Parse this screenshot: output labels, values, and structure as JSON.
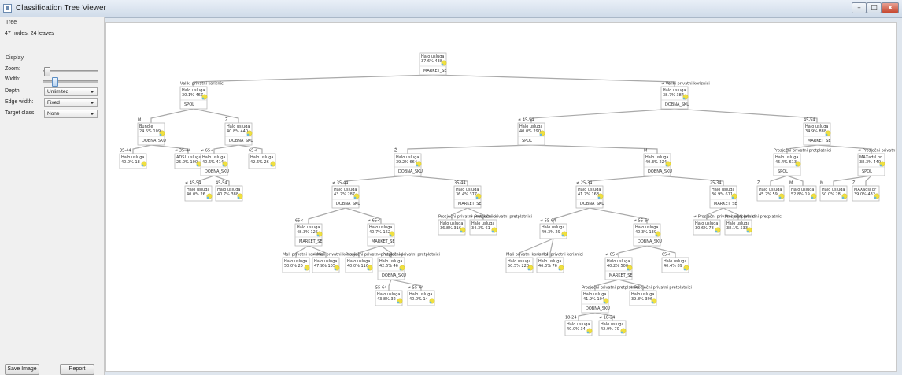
{
  "window": {
    "title": "Classification Tree Viewer",
    "min": "–",
    "max": "□",
    "close": "x"
  },
  "panel": {
    "tree_group": "Tree",
    "info": "47 nodes, 24 leaves",
    "display_group": "Display",
    "zoom_label": "Zoom:",
    "zoom_value": 0.1,
    "width_label": "Width:",
    "width_value": 0.22,
    "depth_label": "Depth:",
    "depth_value": "Unlimited",
    "edge_width_label": "Edge width:",
    "edge_width_value": "Fixed",
    "target_class_label": "Target class:",
    "target_class_value": "None",
    "save_button": "Save Image",
    "report_button": "Report"
  },
  "tree": {
    "nodes": [
      {
        "id": "root",
        "l1": "Halo usluga",
        "l2": "37.6% 438",
        "split": "MARKET_SE"
      },
      {
        "id": "a",
        "edge": "Veliki privatni korisnici",
        "l1": "Halo usluga",
        "l2": "30.1% 467",
        "split": "SPOL"
      },
      {
        "id": "b",
        "edge": "≠ Veliki privatni korisnici",
        "l1": "Halo usluga",
        "l2": "38.7% 384",
        "split": "DOBNA_SKU"
      },
      {
        "id": "a1",
        "edge": "M",
        "l1": "Bundle",
        "l2": "24.5% 109",
        "split": "DOBNA_SKU"
      },
      {
        "id": "a2",
        "edge": "Ž",
        "l1": "Halo usluga",
        "l2": "40.8% 440",
        "split": "DOBNA_SKU"
      },
      {
        "id": "a11",
        "edge": "35-44",
        "l1": "Halo usluga",
        "l2": "40.0% 18"
      },
      {
        "id": "a12",
        "edge": "≠ 35-44",
        "l1": "ADSL usluga",
        "l2": "25.0% 100"
      },
      {
        "id": "a21",
        "edge": "≠ 65<",
        "l1": "Halo usluga",
        "l2": "40.6% 414",
        "split": "DOBNA_SKU"
      },
      {
        "id": "a22",
        "edge": "65<",
        "l1": "Halo usluga",
        "l2": "42.6% 26"
      },
      {
        "id": "a211",
        "edge": "≠ 45-54",
        "l1": "Halo usluga",
        "l2": "40.0% 26"
      },
      {
        "id": "a212",
        "edge": "45-54",
        "l1": "Halo usluga",
        "l2": "40.7% 388"
      },
      {
        "id": "b1",
        "edge": "≠ 45-54",
        "l1": "Halo usluga",
        "l2": "40.0% 290",
        "split": "SPOL"
      },
      {
        "id": "b2",
        "edge": "45-54",
        "l1": "Halo usluga",
        "l2": "34.9% 888",
        "split": "MARKET_SE"
      },
      {
        "id": "b11",
        "edge": "Ž",
        "l1": "Halo usluga",
        "l2": "39.2% 664",
        "split": "DOBNA_SKU"
      },
      {
        "id": "b12",
        "edge": "M",
        "l1": "Halo usluga",
        "l2": "40.3% 224",
        "split": "DOBNA_SKU"
      },
      {
        "id": "b111",
        "edge": "≠ 35-44",
        "l1": "Halo usluga",
        "l2": "43.7% 287",
        "split": "DOBNA_SKU"
      },
      {
        "id": "b112",
        "edge": "35-44",
        "l1": "Halo usluga",
        "l2": "36.4% 377",
        "split": "MARKET_SE"
      },
      {
        "id": "b1111",
        "edge": "65<",
        "l1": "Halo usluga",
        "l2": "48.3% 125",
        "split": "MARKET_SE"
      },
      {
        "id": "b1112",
        "edge": "≠ 65<",
        "l1": "Halo usluga",
        "l2": "40.7% 162",
        "split": "MARKET_SE"
      },
      {
        "id": "l1",
        "edge": "Mali privatni korisnici",
        "l1": "Halo usluga",
        "l2": "50.0% 20"
      },
      {
        "id": "l2",
        "edge": "≠ Mali privatni korisnici",
        "l1": "Halo usluga",
        "l2": "47.9% 105"
      },
      {
        "id": "l3",
        "edge": "Prosječni privatni pretplatnici",
        "l1": "Halo usluga",
        "l2": "40.0% 116"
      },
      {
        "id": "l4",
        "edge": "≠ Prosječni privatni pretplatnici",
        "l1": "Halo usluga",
        "l2": "42.6% 46",
        "split": "DOBNA_SKU"
      },
      {
        "id": "l41",
        "edge": "55-64",
        "l1": "Halo usluga",
        "l2": "43.8% 32"
      },
      {
        "id": "l42",
        "edge": "≠ 55-64",
        "l1": "Halo usluga",
        "l2": "40.0% 14"
      },
      {
        "id": "l5",
        "edge": "Prosječni privatni pretplatnici",
        "l1": "Halo usluga",
        "l2": "36.8% 316"
      },
      {
        "id": "l6",
        "edge": "≠ Prosječni privatni pretplatnici",
        "l1": "Halo usluga",
        "l2": "34.3% 61"
      },
      {
        "id": "b121",
        "edge": "≠ 25-34",
        "l1": "Halo usluga",
        "l2": "41.7% 168",
        "split": "DOBNA_SKU"
      },
      {
        "id": "b122",
        "edge": "25-34",
        "l1": "Halo usluga",
        "l2": "36.9% 611",
        "split": "MARKET_SE"
      },
      {
        "id": "m1",
        "edge": "≠ 55-64",
        "l1": "Halo usluga",
        "l2": "49.3% 29"
      },
      {
        "id": "m2",
        "edge": "≠ 55-64",
        "l1": "Halo usluga",
        "l2": "40.3% 139",
        "split": "DOBNA_SKU"
      },
      {
        "id": "m11",
        "edge": "Mali privatni korisnici",
        "l1": "Halo usluga",
        "l2": "50.5% 220"
      },
      {
        "id": "m12",
        "edge": "≠ Mali privatni korisnici",
        "l1": "Halo usluga",
        "l2": "46.3% 76"
      },
      {
        "id": "m21",
        "edge": "≠ 65<",
        "l1": "Halo usluga",
        "l2": "40.2% 500",
        "split": "MARKET_SE"
      },
      {
        "id": "m22",
        "edge": "65<",
        "l1": "Halo usluga",
        "l2": "40.4% 89"
      },
      {
        "id": "m211",
        "edge": "Prosječni privatni pretplatnici",
        "l1": "Halo usluga",
        "l2": "41.9% 104",
        "split": "DOBNA_SKU"
      },
      {
        "id": "m212",
        "edge": "≠ Prosječni privatni pretplatnici",
        "l1": "Halo usluga",
        "l2": "39.8% 396"
      },
      {
        "id": "m2111",
        "edge": "18-24",
        "l1": "Halo usluga",
        "l2": "40.0% 34"
      },
      {
        "id": "m2112",
        "edge": "≠ 18-24",
        "l1": "Halo usluga",
        "l2": "42.9% 70"
      },
      {
        "id": "n1",
        "edge": "≠ Prosječni privatni pretplatnici",
        "l1": "Halo usluga",
        "l2": "30.6% 78"
      },
      {
        "id": "n2",
        "edge": "Prosječni privatni pretplatnici",
        "l1": "Halo usluga",
        "l2": "38.1% 533"
      },
      {
        "id": "b21",
        "edge": "Prosječni privatni pretplatnici",
        "l1": "Halo usluga",
        "l2": "45.4% 613",
        "split": "SPOL"
      },
      {
        "id": "b22",
        "edge": "≠ Prosječni privatni pretplatnici",
        "l1": "MAXadsl pr",
        "l2": "38.3% 440",
        "split": "SPOL"
      },
      {
        "id": "o1",
        "edge": "Ž",
        "l1": "Halo usluga",
        "l2": "45.2% 59"
      },
      {
        "id": "o2",
        "edge": "M",
        "l1": "Halo usluga",
        "l2": "52.8% 19"
      },
      {
        "id": "o3",
        "edge": "M",
        "l1": "Halo usluga",
        "l2": "50.0% 28"
      },
      {
        "id": "o4",
        "edge": "Ž",
        "l1": "MAXadsl pr",
        "l2": "39.0% 432"
      }
    ]
  }
}
